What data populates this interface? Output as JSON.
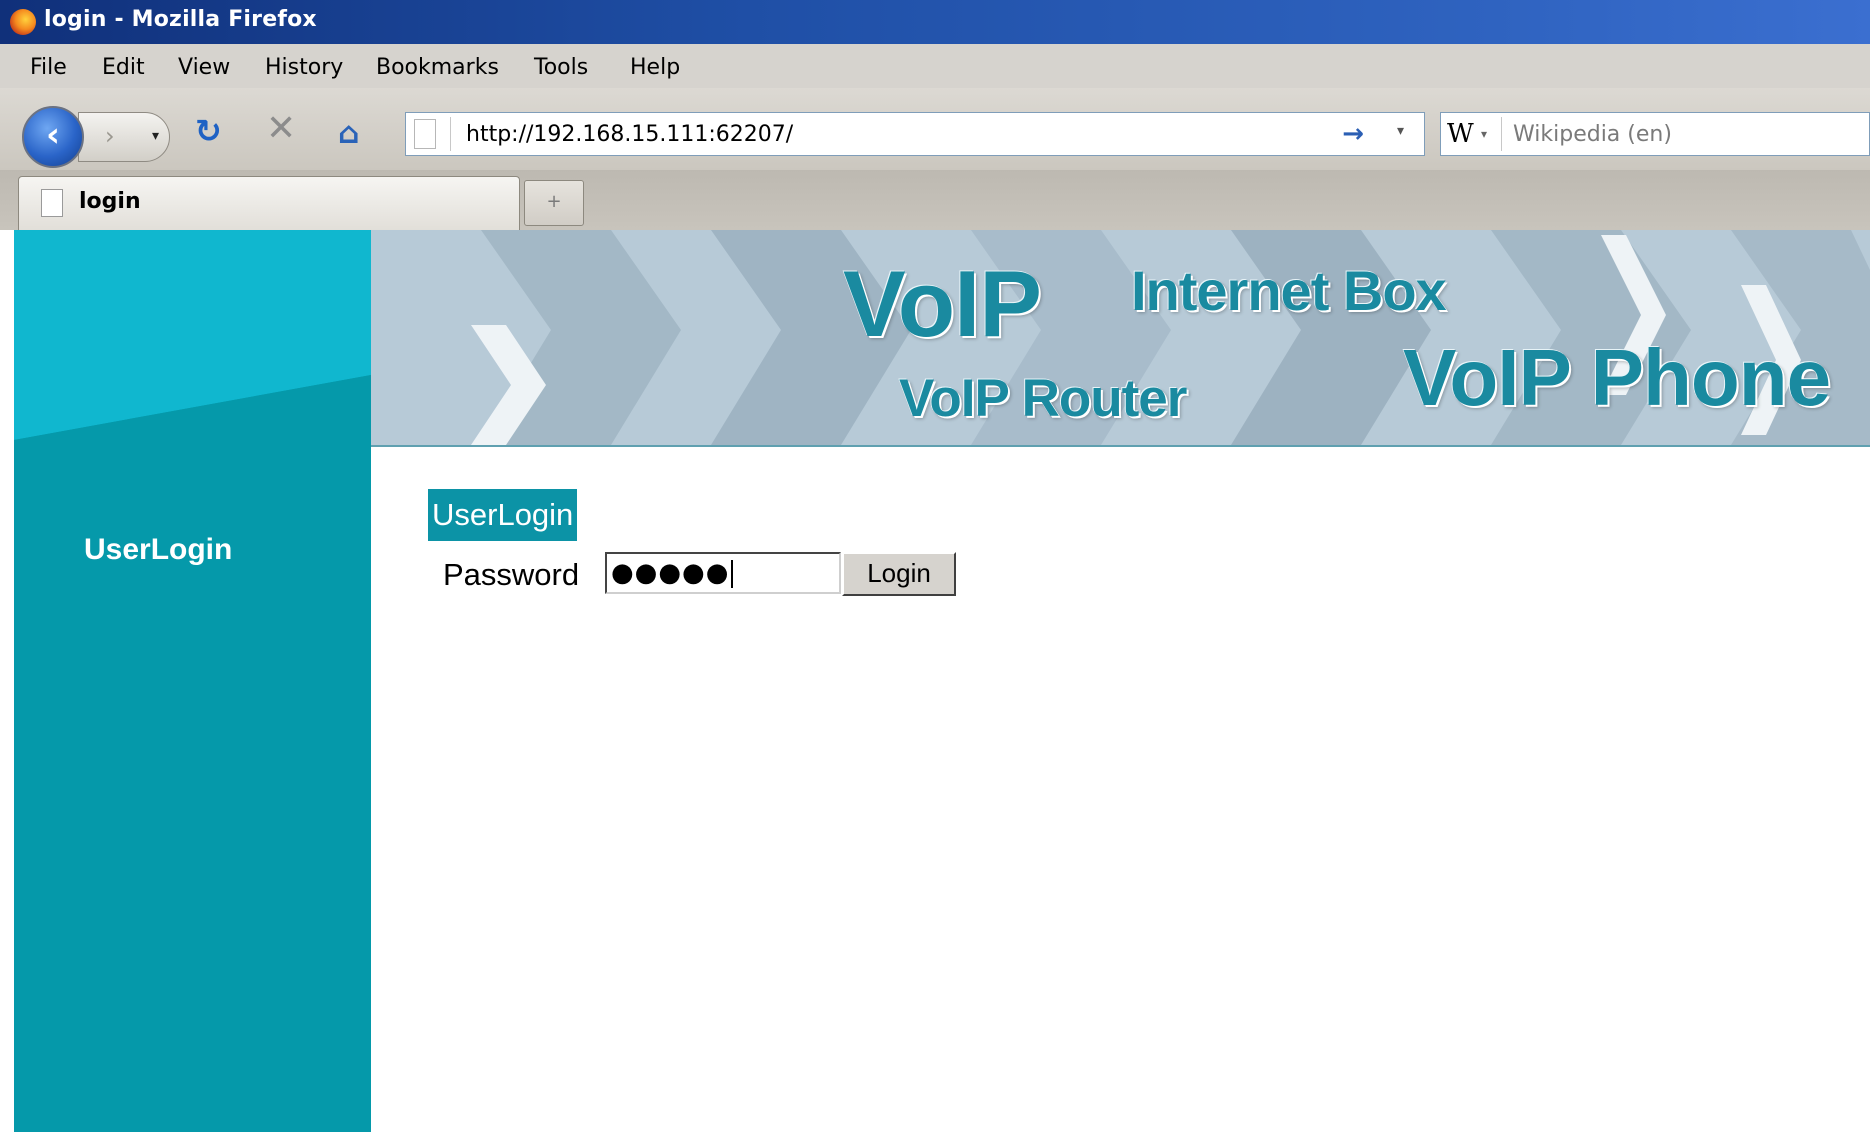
{
  "window": {
    "title": "login - Mozilla Firefox",
    "icon": "firefox-icon"
  },
  "menubar": {
    "items": [
      "File",
      "Edit",
      "View",
      "History",
      "Bookmarks",
      "Tools",
      "Help"
    ]
  },
  "navbar": {
    "back_icon": "back-arrow-icon",
    "forward_icon": "forward-arrow-icon",
    "reload_icon": "reload-icon",
    "stop_icon": "stop-icon",
    "home_icon": "home-icon",
    "url": "http://192.168.15.111:62207/",
    "go_icon": "go-arrow-icon",
    "search_engine": "W",
    "search_placeholder": "Wikipedia (en)"
  },
  "tabs": {
    "active_title": "login",
    "new_tab_symbol": "+"
  },
  "page": {
    "sidebar_label": "UserLogin",
    "banner": {
      "voip": "VoIP",
      "internet_box": "Internet Box",
      "voip_router": "VoIP Router",
      "voip_phone": "VoIP Phone"
    },
    "section_title": "UserLogin",
    "password_label": "Password",
    "password_value": "●●●●●",
    "login_button": "Login"
  },
  "colors": {
    "sidebar": "#0599aa",
    "sidebar_top": "#10b7cf",
    "banner_bg": "#b7cad7",
    "banner_text": "#1a8aa0",
    "title_bar": "#1f4fa6"
  }
}
